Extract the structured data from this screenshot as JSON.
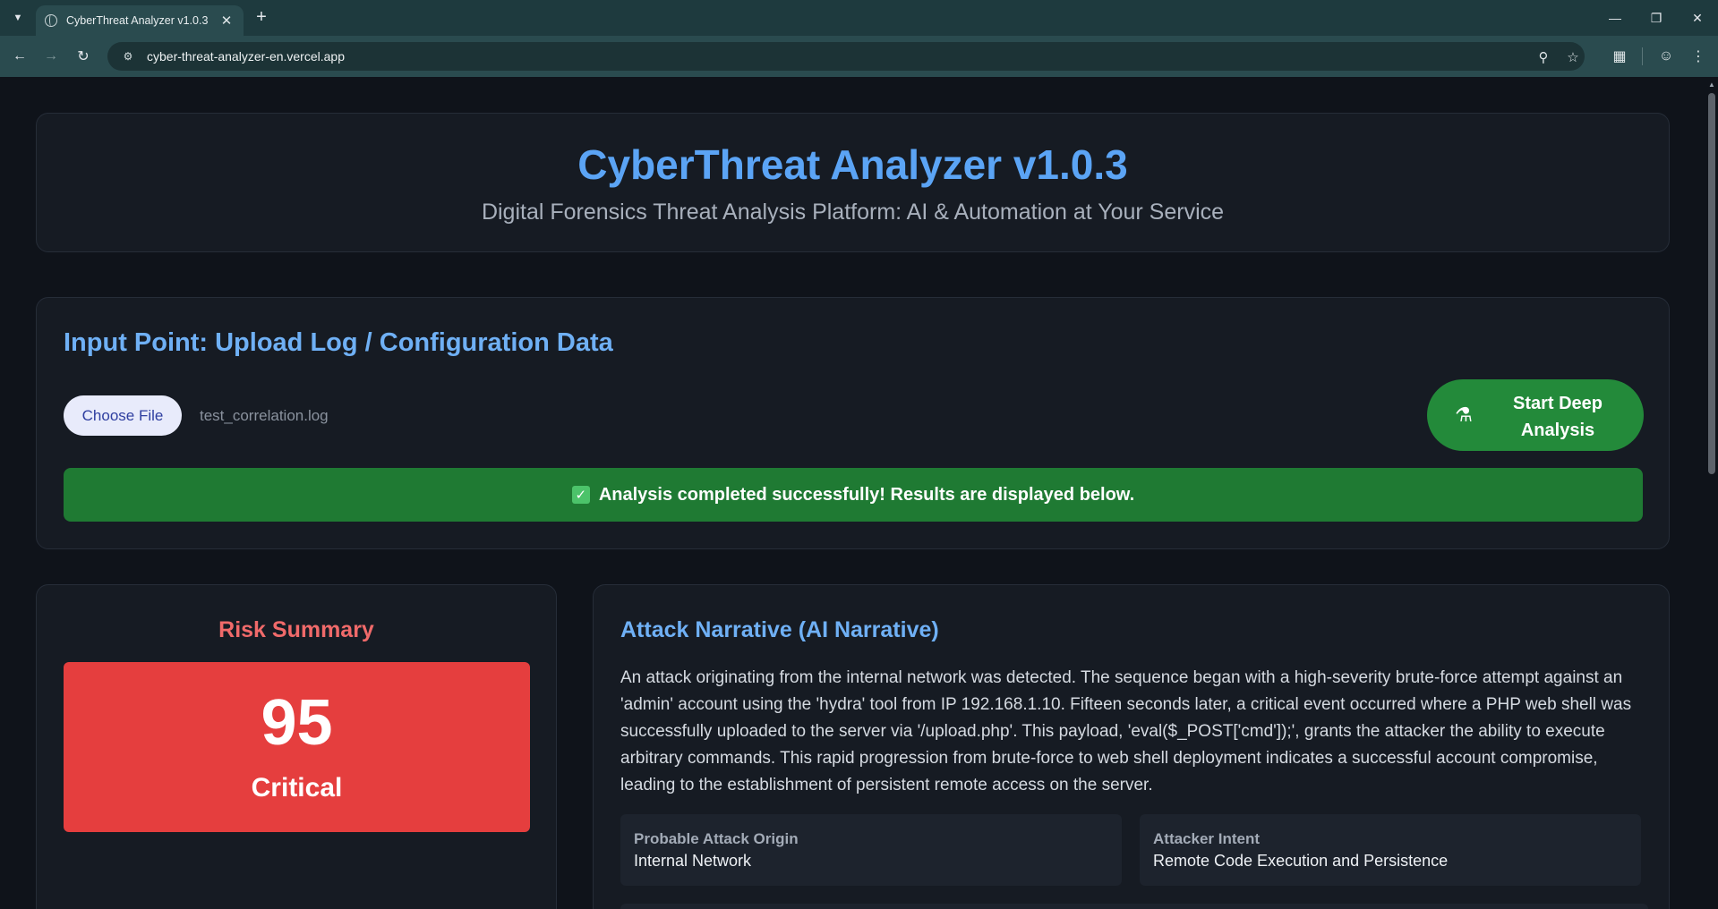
{
  "browser": {
    "tab_title": "CyberThreat Analyzer v1.0.3",
    "url": "cyber-threat-analyzer-en.vercel.app"
  },
  "header": {
    "title": "CyberThreat Analyzer v1.0.3",
    "subtitle": "Digital Forensics Threat Analysis Platform: AI & Automation at Your Service"
  },
  "input": {
    "title": "Input Point: Upload Log / Configuration Data",
    "choose_file_label": "Choose File",
    "file_name": "test_correlation.log",
    "start_button_label": "Start Deep Analysis",
    "status_message": "Analysis completed successfully! Results are displayed below."
  },
  "risk": {
    "title": "Risk Summary",
    "score": "95",
    "level": "Critical",
    "color": "#e53e3e"
  },
  "narrative": {
    "title": "Attack Narrative (AI Narrative)",
    "text": "An attack originating from the internal network was detected. The sequence began with a high-severity brute-force attempt against an 'admin' account using the 'hydra' tool from IP 192.168.1.10. Fifteen seconds later, a critical event occurred where a PHP web shell was successfully uploaded to the server via '/upload.php'. This payload, 'eval($_POST['cmd']);', grants the attacker the ability to execute arbitrary commands. This rapid progression from brute-force to web shell deployment indicates a successful account compromise, leading to the establishment of persistent remote access on the server.",
    "origin_label": "Probable Attack Origin",
    "origin_value": "Internal Network",
    "intent_label": "Attacker Intent",
    "intent_value": "Remote Code Execution and Persistence"
  },
  "colors": {
    "accent": "#5ba4f5",
    "success": "#1f7a33",
    "start_button": "#238a3a",
    "danger": "#e53e3e"
  }
}
